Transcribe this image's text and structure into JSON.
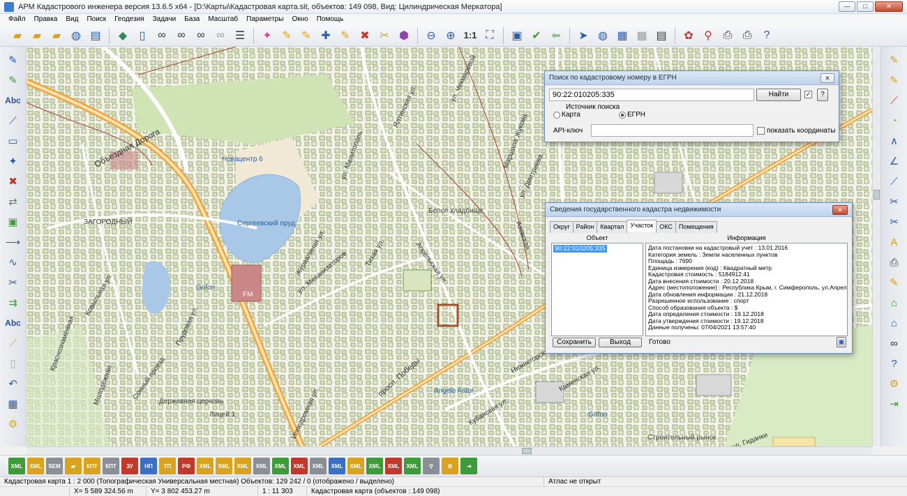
{
  "window": {
    "title": "АРМ Кадастрового инженера версия 13.6.5 x64 - [D:\\Карты\\Кадастровая карта.sit, объектов: 149 098, Вид: Цилиндрическая Меркатора]",
    "min": "—",
    "max": "□",
    "close": "✕"
  },
  "menu": [
    "Файл",
    "Правка",
    "Вид",
    "Поиск",
    "Геодезия",
    "Задачи",
    "База",
    "Масштаб",
    "Параметры",
    "Окно",
    "Помощь"
  ],
  "toolbar": {
    "scale_label": "1:1"
  },
  "left_toolbar": {
    "abc1": "Abc",
    "abc2": "Abc"
  },
  "map": {
    "labels": [
      "Объездная Дорога",
      "Новацентр 6",
      "Сергеевский пруд",
      "Grifon",
      "FM",
      "Белое кладбище",
      "ул. Механизаторов",
      "Ковыльная ул.",
      "Маршала Жукова",
      "Angelo Astor",
      "Державная церковь",
      "Кубанская ул.",
      "просп. Победы",
      "Grifon",
      "Строительный рынок",
      "ул. Гиданки",
      "Нижнегорская ул.",
      "Каменская ул.",
      "Ипподромная ул.",
      "ЗАГОРОДНЫЙ",
      "Лицей 1",
      "Журавлиная ул.",
      "Прудовая ул.",
      "ул. Мелитополь",
      "Тихая ул.",
      "Апрельская ул.",
      "Азовская",
      "Ялтинская ул.",
      "ул. Дмитриева",
      "ул. Чекмаревой",
      "Молодёжная",
      "Краснознамённая",
      "Сонный проезд"
    ]
  },
  "search_dialog": {
    "title": "Поиск по кадастровому номеру в ЕГРН",
    "cadastral_number": "90:22:010205:335",
    "find_button": "Найти",
    "help": "?",
    "source_label": "Источник поиска",
    "radio_map": "Карта",
    "radio_egrn": "ЕГРН",
    "api_label": "API-ключ",
    "api_value": "",
    "show_coords": "показать координаты",
    "close": "✕"
  },
  "cadastre_dialog": {
    "title": "Сведения государственного кадастра недвижимости",
    "tabs": [
      "Округ",
      "Район",
      "Квартал",
      "Участок",
      "ОКС",
      "Помещения"
    ],
    "active_tab": "Участок",
    "col_object": "Объект",
    "col_info": "Информация",
    "selected_object": "90:22:010205:335",
    "info_lines": [
      "Дата постановки на кадастровый учет : 13.01.2016",
      "Категория земель : Земли населенных пунктов",
      "Площадь : 7690",
      "Единица измерения (код) : Квадратный метр",
      "Кадастровая стоимость : 5184912.41",
      "Дата внесения стоимости : 20.12.2018",
      "Адрес (местоположение) : Республика Крым, г. Симферополь, ул.Апрельская\\",
      "Дата обновления информации : 21.12.2018",
      "Разрешенное использование : спорт",
      "Способ образования объекта : $",
      "Дата определения стоимости : 19.12.2018",
      "Дата утверждения стоимости : 19.12.2018",
      "Данные получены: 07/04/2021 13:57:40"
    ],
    "save_button": "Сохранить",
    "exit_button": "Выход",
    "status": "Готово",
    "close": "✕"
  },
  "status": {
    "row1_left": "Кадастровая карта  1 : 2 000 (Топографическая Универсальная местная) Объектов: 129 242 / 0 (отображено / выделено)",
    "row1_right": "Атлас не открыт",
    "x": "X=  5 589 324.56 m",
    "y": "Y= 3 802 453.27 m",
    "scale": "1 : 11 303",
    "map_info": "Кадастровая карта   (объектов : 149 098)"
  },
  "colors": {
    "accent": "#3399ff",
    "road": "#f0a33a",
    "water": "#a9c8e8",
    "park": "#cfe3b4"
  }
}
